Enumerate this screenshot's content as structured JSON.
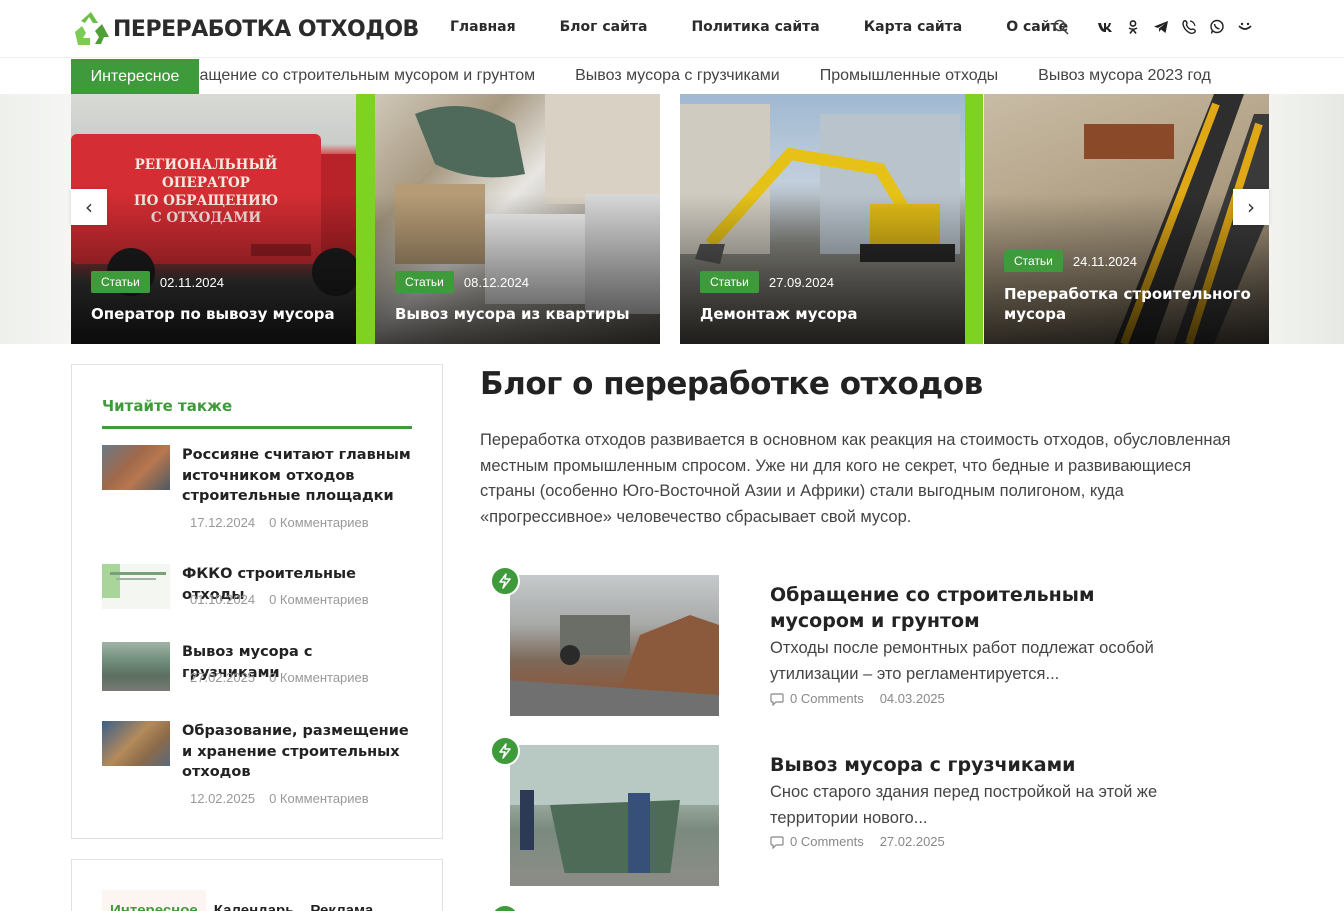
{
  "site": {
    "logo_text": "ПЕРЕРАБОТКА ОТХОДОВ",
    "nav": [
      "Главная",
      "Блог сайта",
      "Политика сайта",
      "Карта сайта",
      "О сайте"
    ],
    "icons": [
      "search-icon",
      "vk-icon",
      "odnoklassniki-icon",
      "telegram-icon",
      "viber-icon",
      "whatsapp-icon",
      "max-icon"
    ]
  },
  "ticker": {
    "badge": "Интересное",
    "items": [
      "Обращение со строительным мусором и грунтом",
      "Вывоз мусора с грузчиками",
      "Промышленные отходы",
      "Вывоз мусора 2023 год"
    ]
  },
  "slider": {
    "prev": "‹",
    "next": "›",
    "slides": [
      {
        "category": "Статьи",
        "date": "02.11.2024",
        "title": "Оператор по вывозу мусора",
        "truck_text": "РЕГИОНАЛЬНЫЙ ОПЕРАТОР ПО ОБРАЩЕНИЮ С ОТХОДАМИ"
      },
      {
        "category": "Статьи",
        "date": "08.12.2024",
        "title": "Вывоз мусора из квартиры"
      },
      {
        "category": "Статьи",
        "date": "27.09.2024",
        "title": "Демонтаж мусора"
      },
      {
        "category": "Статьи",
        "date": "24.11.2024",
        "title": "Переработка строительного мусора"
      }
    ]
  },
  "sidebar": {
    "heading": "Читайте также",
    "items": [
      {
        "title": "Россияне считают главным источником отходов строительные площадки",
        "date": "17.12.2024",
        "comments": "0 Комментариев"
      },
      {
        "title": "ФККО строительные отходы",
        "date": "01.10.2024",
        "comments": "0 Комментариев"
      },
      {
        "title": "Вывоз мусора с грузчиками",
        "date": "27.02.2025",
        "comments": "0 Комментариев"
      },
      {
        "title": "Образование, размещение и хранение строительных отходов",
        "date": "12.02.2025",
        "comments": "0 Комментариев"
      }
    ],
    "tabs": [
      "Интересное",
      "Календарь",
      "Реклама"
    ]
  },
  "main": {
    "title": "Блог о переработке отходов",
    "intro": "Переработка отходов развивается в основном как реакция на стоимость отходов, обусловленная местным промышленным спросом. Уже ни для кого не секрет, что бедные и развивающиеся страны (особенно Юго-Восточной Азии и Африки) стали выгодным полигоном, куда «прогрессивное» человечество сбрасывает свой мусор.",
    "posts": [
      {
        "title": "Обращение со строительным мусором и грунтом",
        "excerpt": "Отходы после ремонтных работ подлежат особой утилизации – это регламентируется...",
        "comments": "0 Comments",
        "date": "04.03.2025"
      },
      {
        "title": "Вывоз мусора с грузчиками",
        "excerpt": "Снос старого здания перед постройкой на этой же территории нового...",
        "comments": "0 Comments",
        "date": "27.02.2025"
      }
    ]
  },
  "colors": {
    "accent": "#3f9a3c",
    "lime": "#7ed321",
    "text": "#222222"
  }
}
